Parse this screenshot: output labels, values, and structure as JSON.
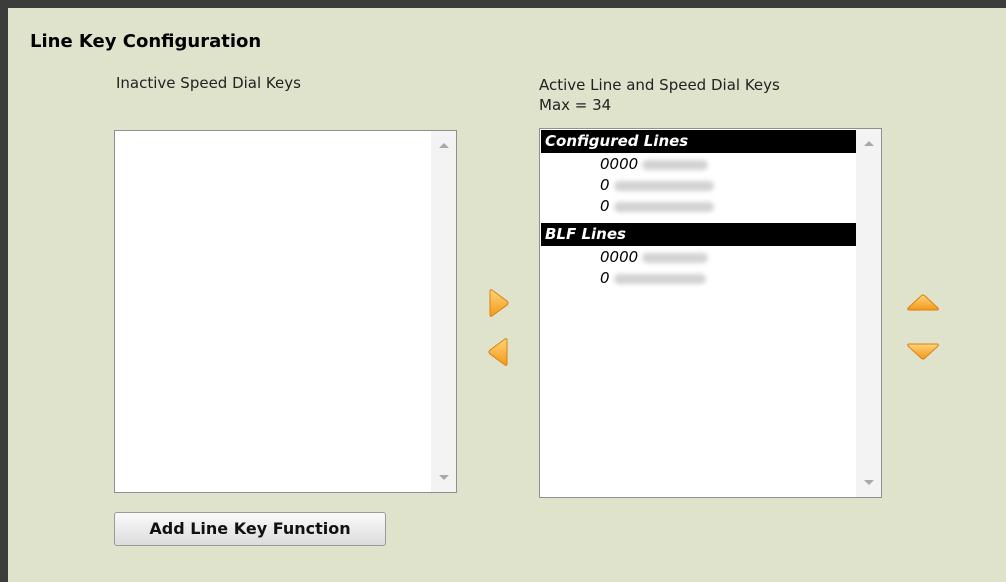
{
  "title": "Line Key Configuration",
  "inactive": {
    "label": "Inactive Speed Dial Keys"
  },
  "active": {
    "label": "Active Line and Speed Dial Keys",
    "max_label": "Max = 34",
    "groups": [
      {
        "header": "Configured Lines",
        "items": [
          "0000",
          "0",
          "0"
        ]
      },
      {
        "header": "BLF Lines",
        "items": [
          "0000",
          "0"
        ]
      }
    ]
  },
  "controls": {
    "move_right_icon": "arrow-right-icon",
    "move_left_icon": "arrow-left-icon",
    "move_up_icon": "arrow-up-icon",
    "move_down_icon": "arrow-down-icon",
    "accent_color": "#f5a623"
  },
  "button": {
    "label": "Add Line Key Function"
  }
}
